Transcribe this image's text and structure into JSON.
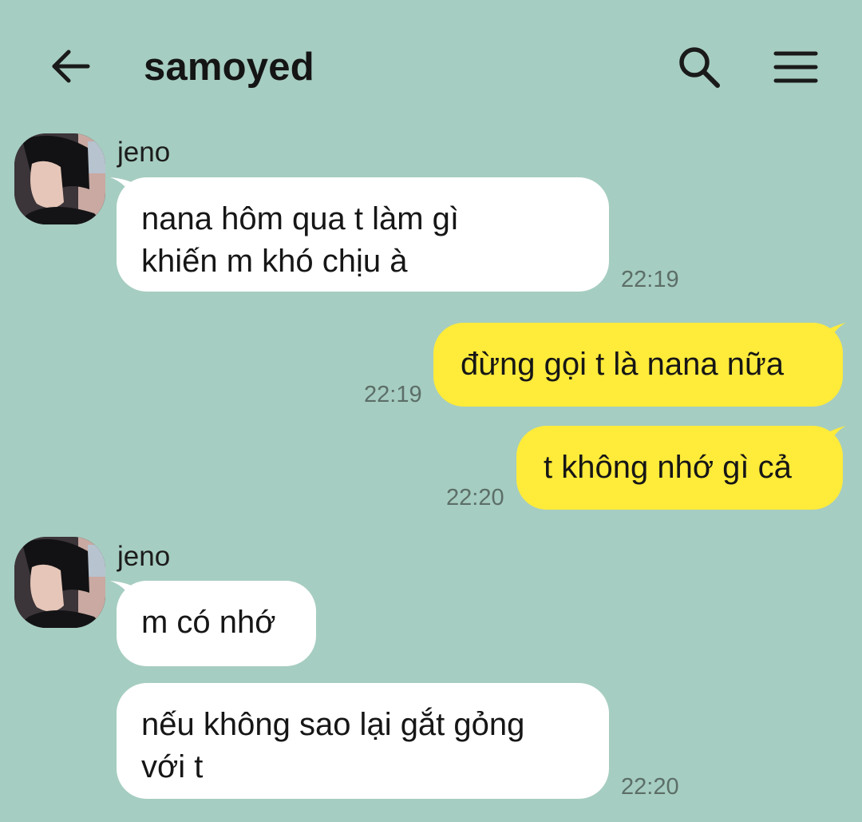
{
  "header": {
    "title": "samoyed",
    "back_icon": "arrow-left-icon",
    "search_icon": "search-icon",
    "menu_icon": "hamburger-menu-icon"
  },
  "colors": {
    "background": "#a6cdc1",
    "incoming_bubble": "#ffffff",
    "outgoing_bubble": "#feeb3a",
    "timestamp": "#5c6e68"
  },
  "messages": [
    {
      "direction": "incoming",
      "sender": "jeno",
      "text": "nana hôm qua t làm gì\nkhiến m khó chịu à",
      "time": "22:19"
    },
    {
      "direction": "outgoing",
      "text": "đừng gọi t là nana nữa",
      "time": "22:19"
    },
    {
      "direction": "outgoing",
      "text": "t không nhớ gì cả",
      "time": "22:20"
    },
    {
      "direction": "incoming",
      "sender": "jeno",
      "text": "m có nhớ",
      "time": ""
    },
    {
      "direction": "incoming",
      "text": "nếu không sao lại gắt gỏng\nvới t",
      "time": "22:20"
    }
  ]
}
